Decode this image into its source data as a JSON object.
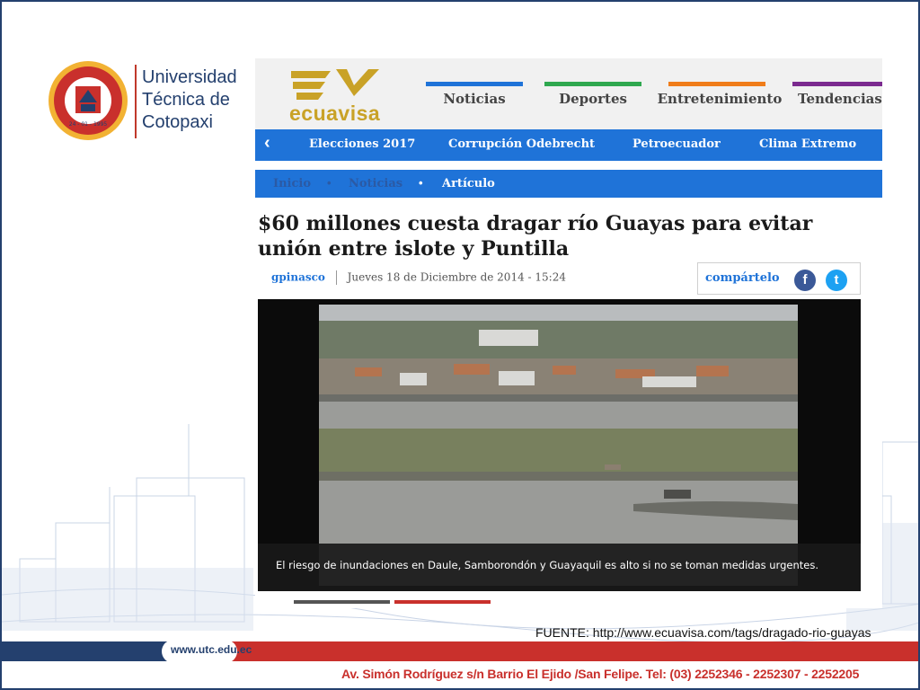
{
  "university": {
    "name_line1": "Universidad",
    "name_line2": "Técnica de",
    "name_line3": "Cotopaxi",
    "seal_text_top": "UNIVERSIDAD TÉCNICA DE COTOPAXI",
    "seal_text_bottom": "LATACUNGA - ECUADOR",
    "seal_monogram": "UTC"
  },
  "ecuavisa": {
    "logo_text": "ecuavisa",
    "tabs": [
      {
        "label": "Noticias",
        "color": "#1f73d8"
      },
      {
        "label": "Deportes",
        "color": "#2fa84f"
      },
      {
        "label": "Entretenimiento",
        "color": "#f07d1a"
      },
      {
        "label": "Tendencias",
        "color": "#7b2a8f"
      }
    ],
    "subnav": [
      "Elecciones 2017",
      "Corrupción Odebrecht",
      "Petroecuador",
      "Clima Extremo"
    ],
    "breadcrumb": [
      "Inicio",
      "Noticias",
      "Artículo"
    ],
    "headline": "$60 millones cuesta dragar río Guayas para evitar unión entre islote y Puntilla",
    "author": "gpinasco",
    "date": "Jueves 18 de Diciembre de 2014 - 15:24",
    "share_label": "compártelo",
    "caption": "El riesgo de inundaciones en Daule, Samborondón y Guayaquil es alto si no se toman medidas urgentes."
  },
  "source": "FUENTE:  http://www.ecuavisa.com/tags/dragado-rio-guayas",
  "footer": {
    "url": "www.utc.edu.ec",
    "address": "Av. Simón Rodríguez s/n Barrio El Ejido /San Felipe.   Tel: (03) 2252346 - 2252307 - 2252205"
  },
  "colors": {
    "brand_blue": "#24406e",
    "brand_red": "#c9302c",
    "ecuavisa_blue": "#1f73d8",
    "ecuavisa_gold": "#c9a227"
  }
}
